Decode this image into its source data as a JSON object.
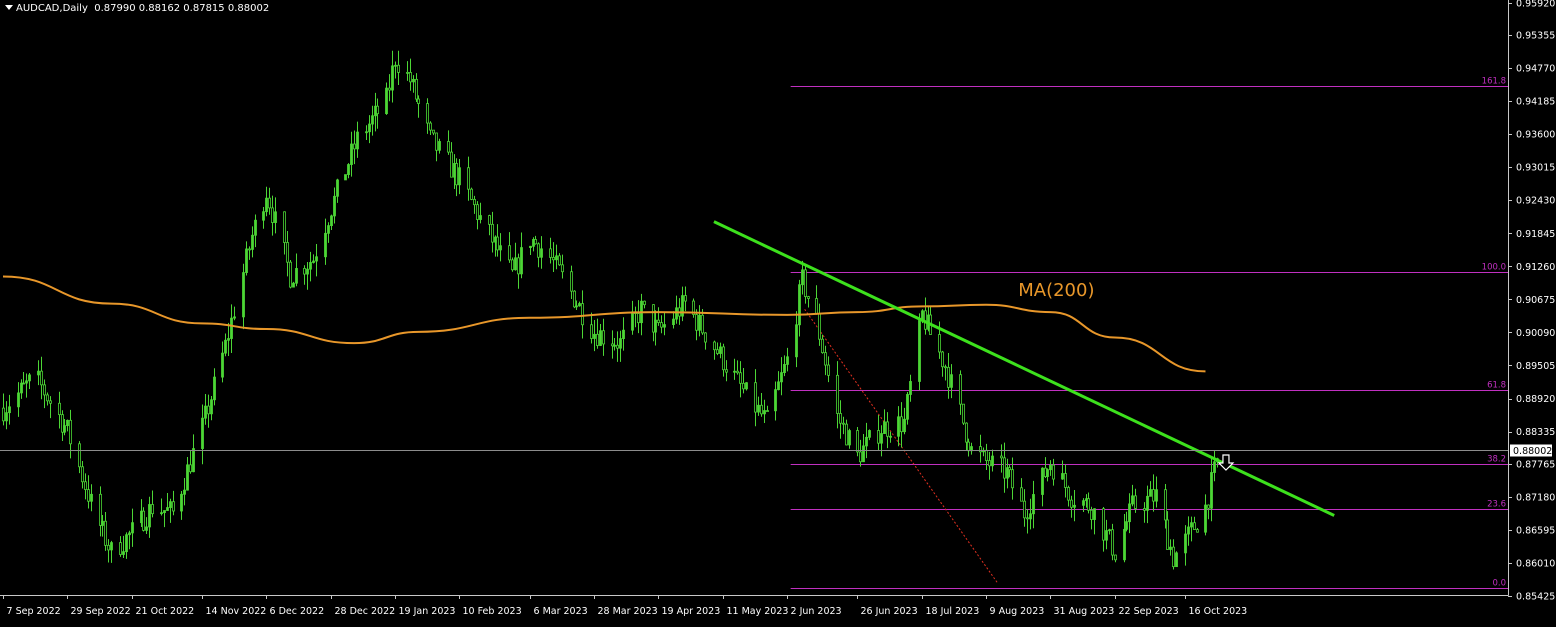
{
  "header": {
    "symbol": "AUDCAD,Daily",
    "ohlc": "0.87990 0.88162 0.87815 0.88002"
  },
  "chart_data": {
    "type": "candlestick",
    "ylim": [
      0.85425,
      0.9592
    ],
    "y_ticks": [
      "0.95920",
      "0.95355",
      "0.94770",
      "0.94185",
      "0.93600",
      "0.93015",
      "0.92430",
      "0.91845",
      "0.91260",
      "0.90675",
      "0.90090",
      "0.89505",
      "0.88920",
      "0.88335",
      "0.87765",
      "0.87180",
      "0.86595",
      "0.86010",
      "0.85425"
    ],
    "x_ticks": [
      {
        "label": "7 Sep 2022",
        "date": "2022-09-07"
      },
      {
        "label": "29 Sep 2022",
        "date": "2022-09-29"
      },
      {
        "label": "21 Oct 2022",
        "date": "2022-10-21"
      },
      {
        "label": "14 Nov 2022",
        "date": "2022-11-14"
      },
      {
        "label": "6 Dec 2022",
        "date": "2022-12-06"
      },
      {
        "label": "28 Dec 2022",
        "date": "2022-12-28"
      },
      {
        "label": "19 Jan 2023",
        "date": "2023-01-19"
      },
      {
        "label": "10 Feb 2023",
        "date": "2023-02-10"
      },
      {
        "label": "6 Mar 2023",
        "date": "2023-03-06"
      },
      {
        "label": "28 Mar 2023",
        "date": "2023-03-28"
      },
      {
        "label": "19 Apr 2023",
        "date": "2023-04-19"
      },
      {
        "label": "11 May 2023",
        "date": "2023-05-11"
      },
      {
        "label": "2 Jun 2023",
        "date": "2023-06-02"
      },
      {
        "label": "26 Jun 2023",
        "date": "2023-06-26"
      },
      {
        "label": "18 Jul 2023",
        "date": "2023-07-18"
      },
      {
        "label": "9 Aug 2023",
        "date": "2023-08-09"
      },
      {
        "label": "31 Aug 2023",
        "date": "2023-08-31"
      },
      {
        "label": "22 Sep 2023",
        "date": "2023-09-22"
      },
      {
        "label": "16 Oct 2023",
        "date": "2023-10-16"
      }
    ],
    "price_path": [
      [
        "2022-09-07",
        0.8875
      ],
      [
        "2022-09-18",
        0.893
      ],
      [
        "2022-09-29",
        0.8835
      ],
      [
        "2022-10-08",
        0.869
      ],
      [
        "2022-10-14",
        0.862
      ],
      [
        "2022-10-21",
        0.8655
      ],
      [
        "2022-10-28",
        0.87
      ],
      [
        "2022-11-04",
        0.869
      ],
      [
        "2022-11-14",
        0.884
      ],
      [
        "2022-11-22",
        0.8985
      ],
      [
        "2022-12-01",
        0.918
      ],
      [
        "2022-12-06",
        0.926
      ],
      [
        "2022-12-14",
        0.911
      ],
      [
        "2022-12-22",
        0.914
      ],
      [
        "2022-12-28",
        0.923
      ],
      [
        "2023-01-06",
        0.935
      ],
      [
        "2023-01-16",
        0.942
      ],
      [
        "2023-01-19",
        0.9495
      ],
      [
        "2023-01-24",
        0.9455
      ],
      [
        "2023-01-31",
        0.935
      ],
      [
        "2023-02-10",
        0.928
      ],
      [
        "2023-02-18",
        0.92
      ],
      [
        "2023-02-28",
        0.911
      ],
      [
        "2023-03-06",
        0.9175
      ],
      [
        "2023-03-12",
        0.915
      ],
      [
        "2023-03-20",
        0.908
      ],
      [
        "2023-03-28",
        0.901
      ],
      [
        "2023-04-06",
        0.899
      ],
      [
        "2023-04-13",
        0.905
      ],
      [
        "2023-04-19",
        0.901
      ],
      [
        "2023-04-28",
        0.906
      ],
      [
        "2023-05-06",
        0.9
      ],
      [
        "2023-05-11",
        0.896
      ],
      [
        "2023-05-20",
        0.889
      ],
      [
        "2023-05-26",
        0.885
      ],
      [
        "2023-06-02",
        0.896
      ],
      [
        "2023-06-07",
        0.91
      ],
      [
        "2023-06-12",
        0.903
      ],
      [
        "2023-06-19",
        0.886
      ],
      [
        "2023-06-26",
        0.879
      ],
      [
        "2023-07-04",
        0.884
      ],
      [
        "2023-07-12",
        0.885
      ],
      [
        "2023-07-18",
        0.904
      ],
      [
        "2023-07-26",
        0.895
      ],
      [
        "2023-08-04",
        0.88
      ],
      [
        "2023-08-09",
        0.878
      ],
      [
        "2023-08-16",
        0.876
      ],
      [
        "2023-08-22",
        0.869
      ],
      [
        "2023-08-31",
        0.878
      ],
      [
        "2023-09-07",
        0.872
      ],
      [
        "2023-09-14",
        0.87
      ],
      [
        "2023-09-22",
        0.862
      ],
      [
        "2023-09-28",
        0.87
      ],
      [
        "2023-10-06",
        0.872
      ],
      [
        "2023-10-12",
        0.861
      ],
      [
        "2023-10-16",
        0.864
      ],
      [
        "2023-10-23",
        0.87
      ],
      [
        "2023-10-28",
        0.88
      ]
    ],
    "ma200": {
      "label": "MA(200)",
      "points": [
        [
          "2022-09-07",
          0.9108
        ],
        [
          "2022-10-14",
          0.906
        ],
        [
          "2022-11-14",
          0.9025
        ],
        [
          "2022-12-06",
          0.9015
        ],
        [
          "2023-01-05",
          0.899
        ],
        [
          "2023-01-27",
          0.901
        ],
        [
          "2023-03-06",
          0.9035
        ],
        [
          "2023-04-19",
          0.9045
        ],
        [
          "2023-06-02",
          0.904
        ],
        [
          "2023-06-26",
          0.9045
        ],
        [
          "2023-07-18",
          0.9055
        ],
        [
          "2023-08-09",
          0.9058
        ],
        [
          "2023-08-31",
          0.9045
        ],
        [
          "2023-09-22",
          0.9
        ],
        [
          "2023-10-23",
          0.894
        ]
      ]
    },
    "trendline": [
      [
        "2023-05-08",
        0.9205
      ],
      [
        "2023-12-06",
        0.8685
      ]
    ],
    "fib_diagonal": [
      [
        "2023-06-08",
        0.905
      ],
      [
        "2023-08-13",
        0.8565
      ]
    ],
    "fibonacci": [
      {
        "label": "161.8",
        "value": 0.94455
      },
      {
        "label": "100.0",
        "value": 0.9116
      },
      {
        "label": "61.8",
        "value": 0.8907
      },
      {
        "label": "38.2",
        "value": 0.87765
      },
      {
        "label": "23.6",
        "value": 0.8696
      },
      {
        "label": "0.0",
        "value": 0.85565
      }
    ],
    "current_price": {
      "label": "0.88002",
      "value": 0.88002
    },
    "signal": {
      "direction": "down",
      "date": "2023-10-30",
      "value": 0.8792
    },
    "colors": {
      "background": "#000000",
      "grid_axis": "#c8c8c8",
      "candles": "#4cd635",
      "ma": "#e8972a",
      "trendline": "#3de11d",
      "fibonacci": "#c030c0",
      "diagonal": "#e03020",
      "price_line": "#8c8c8c"
    }
  }
}
